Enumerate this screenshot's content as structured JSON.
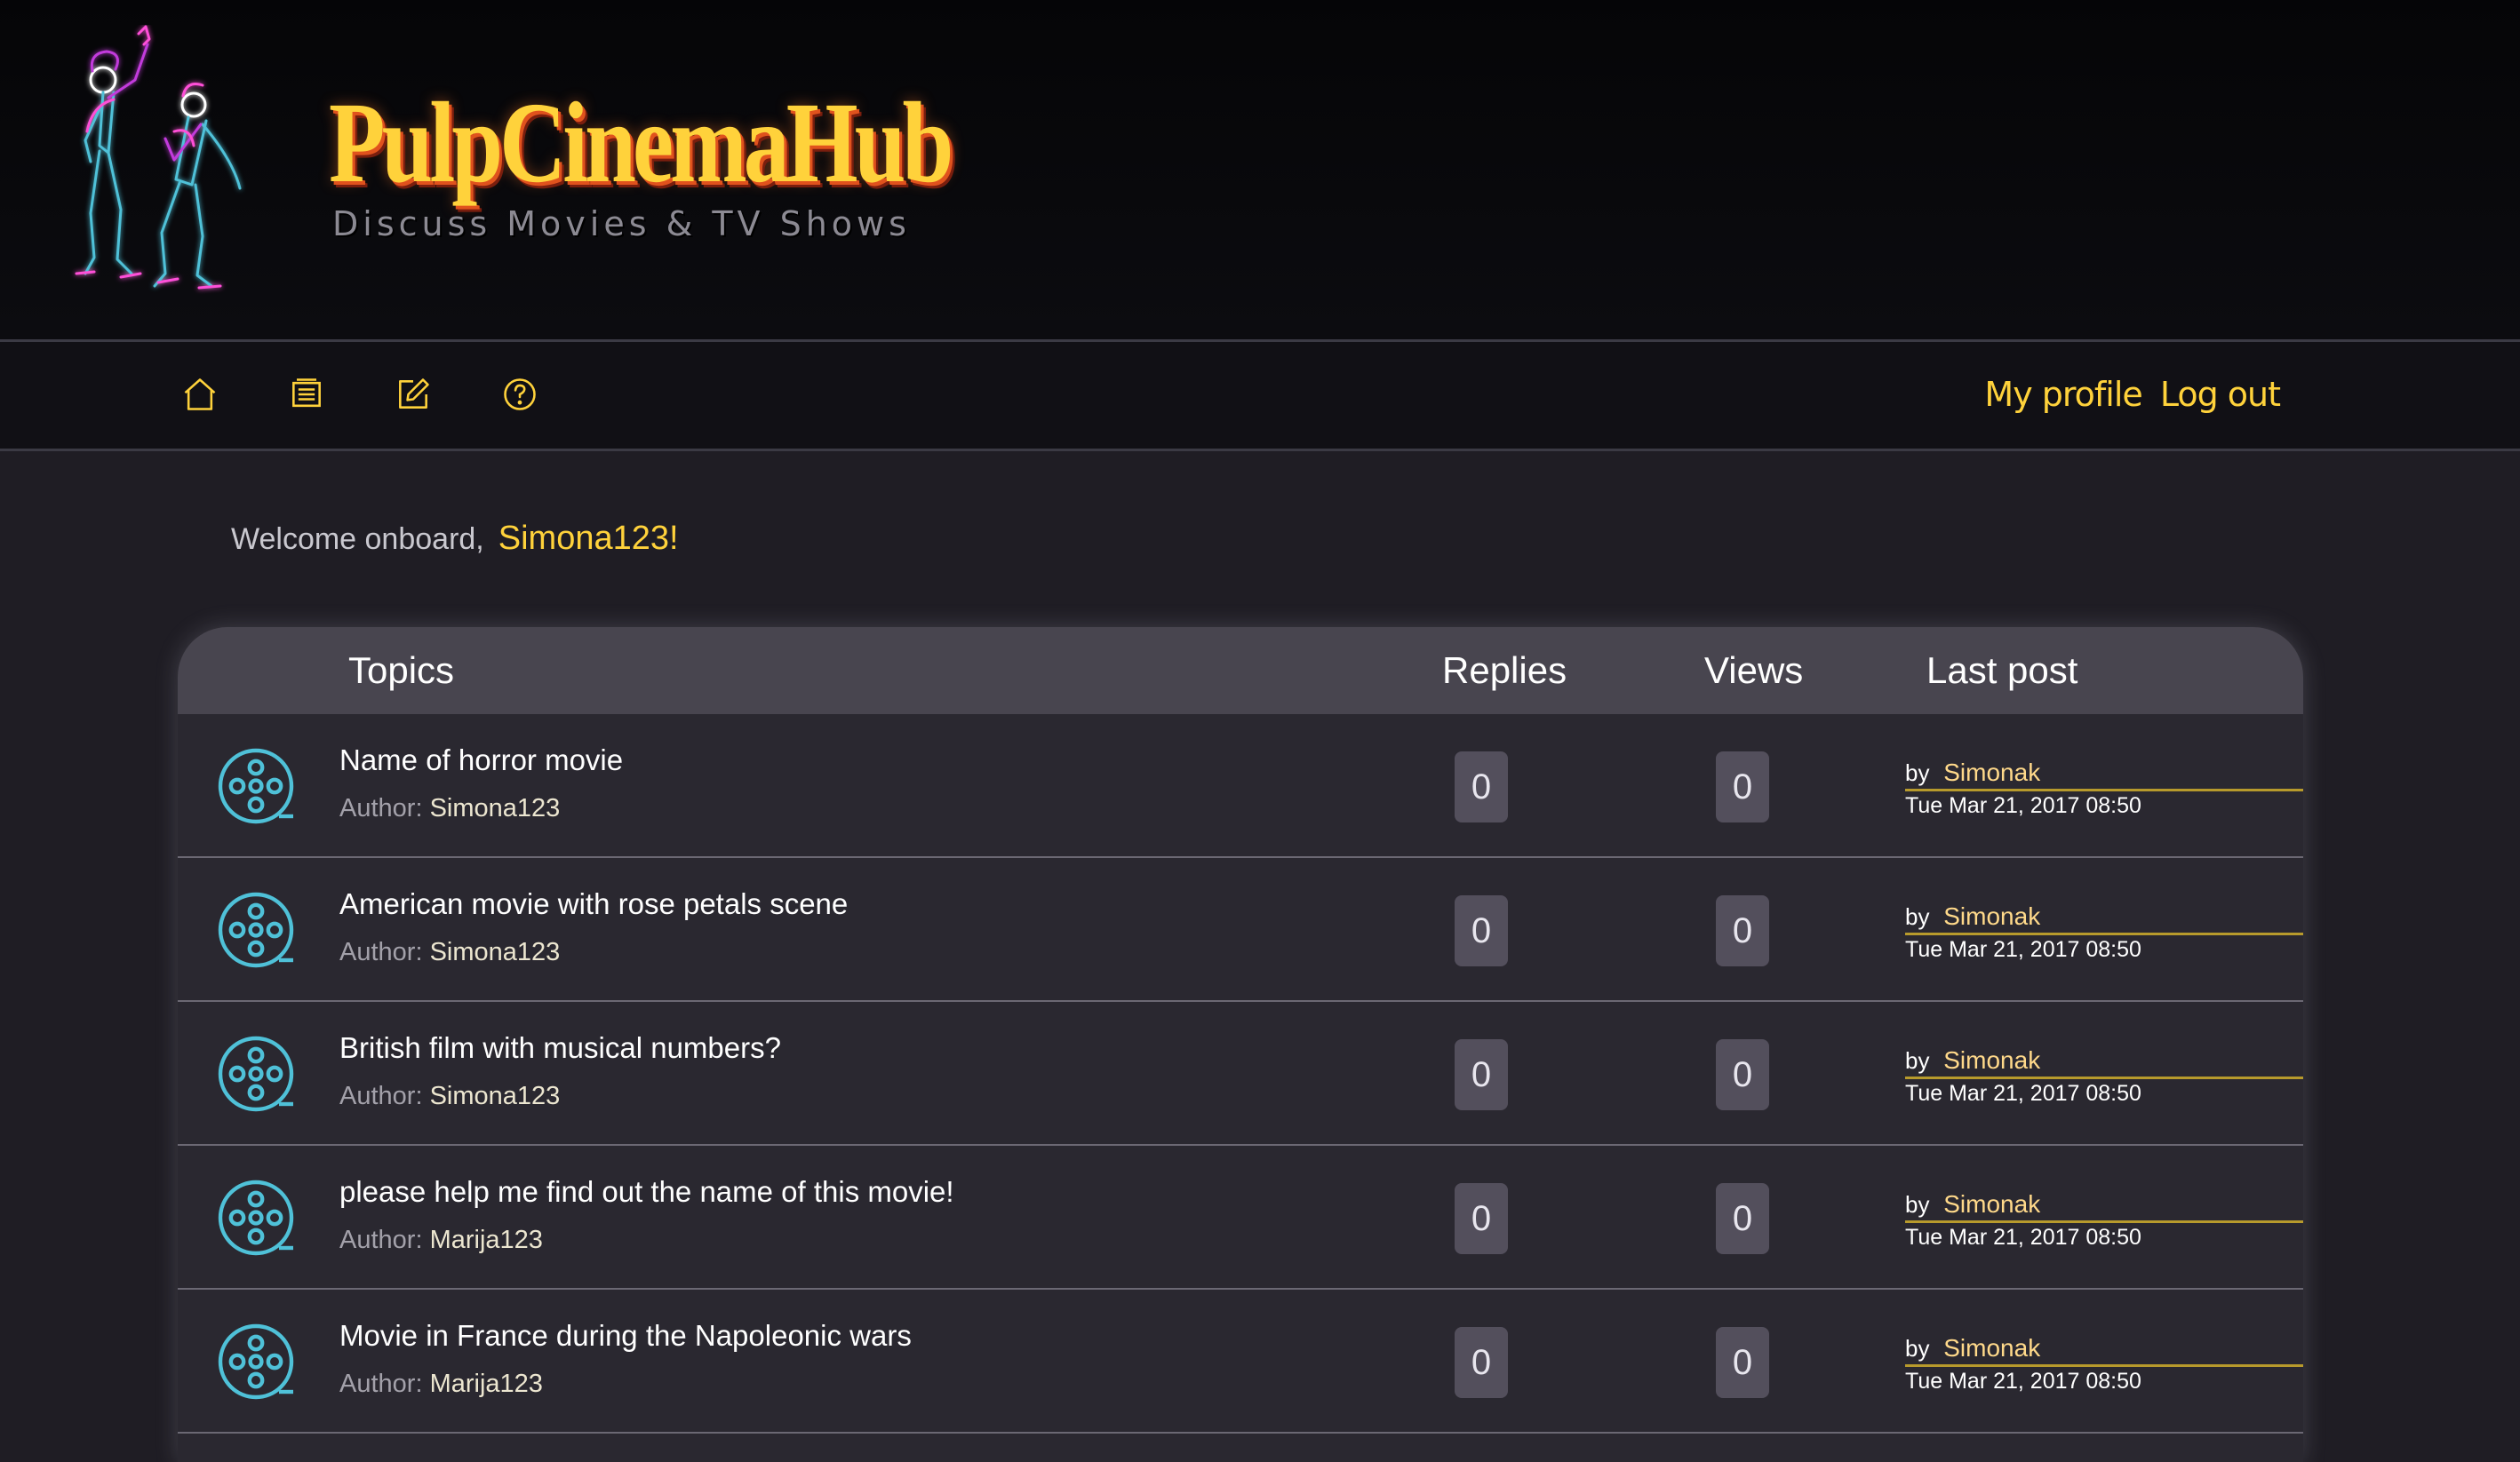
{
  "site": {
    "title": "PulpCinemaHub",
    "tagline": "Discuss Movies & TV Shows",
    "colors": {
      "accent": "#ffd23b",
      "header_bg": "#08080b",
      "table_header_bg": "#48454f",
      "row_bg": "#2a2830",
      "icon_teal": "#4fc1d8"
    }
  },
  "nav": {
    "icons": [
      "home-icon",
      "forum-icon",
      "edit-icon",
      "help-icon"
    ],
    "links": {
      "profile": "My profile",
      "logout": "Log out"
    }
  },
  "welcome": {
    "text": "Welcome onboard,",
    "username": "Simona123!"
  },
  "table": {
    "headers": {
      "topics": "Topics",
      "replies": "Replies",
      "views": "Views",
      "last_post": "Last post"
    },
    "author_label": "Author:",
    "by_label": "by",
    "rows": [
      {
        "title": "Name of horror movie",
        "author": "Simona123",
        "replies": "0",
        "views": "0",
        "last_user": "Simonak",
        "last_date": "Tue Mar 21, 2017 08:50"
      },
      {
        "title": "American movie with rose petals scene",
        "author": "Simona123",
        "replies": "0",
        "views": "0",
        "last_user": "Simonak",
        "last_date": "Tue Mar 21, 2017 08:50"
      },
      {
        "title": "British film with musical numbers?",
        "author": "Simona123",
        "replies": "0",
        "views": "0",
        "last_user": "Simonak",
        "last_date": "Tue Mar 21, 2017 08:50"
      },
      {
        "title": "please help me find out the name of this movie!",
        "author": "Marija123",
        "replies": "0",
        "views": "0",
        "last_user": "Simonak",
        "last_date": "Tue Mar 21, 2017 08:50"
      },
      {
        "title": "Movie in France during the Napoleonic wars",
        "author": "Marija123",
        "replies": "0",
        "views": "0",
        "last_user": "Simonak",
        "last_date": "Tue Mar 21, 2017 08:50"
      }
    ]
  }
}
